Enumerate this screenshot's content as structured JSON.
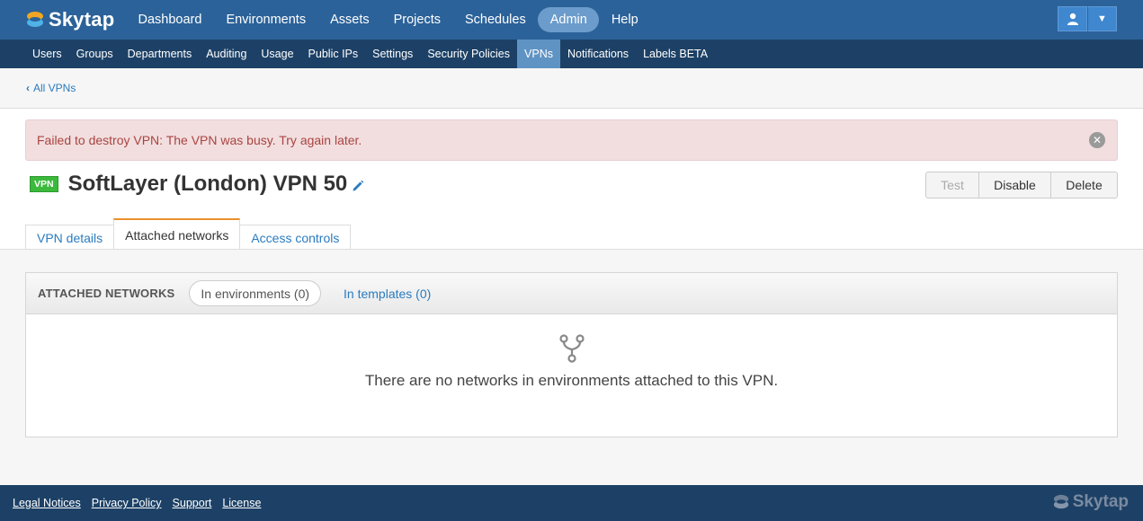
{
  "brand": {
    "name": "Skytap"
  },
  "topnav": {
    "items": [
      {
        "label": "Dashboard"
      },
      {
        "label": "Environments"
      },
      {
        "label": "Assets"
      },
      {
        "label": "Projects"
      },
      {
        "label": "Schedules"
      },
      {
        "label": "Admin",
        "active": true
      },
      {
        "label": "Help"
      }
    ],
    "user_icon": "user-icon",
    "caret_label": "▼"
  },
  "subnav": {
    "items": [
      {
        "label": "Users"
      },
      {
        "label": "Groups"
      },
      {
        "label": "Departments"
      },
      {
        "label": "Auditing"
      },
      {
        "label": "Usage"
      },
      {
        "label": "Public IPs"
      },
      {
        "label": "Settings"
      },
      {
        "label": "Security Policies"
      },
      {
        "label": "VPNs",
        "active": true
      },
      {
        "label": "Notifications"
      },
      {
        "label": "Labels BETA"
      }
    ]
  },
  "breadcrumb": {
    "label": "All VPNs"
  },
  "alert": {
    "message": "Failed to destroy VPN: The VPN was busy. Try again later.",
    "close_label": "✕"
  },
  "vpn": {
    "badge": "VPN",
    "title": "SoftLayer (London) VPN 50"
  },
  "actions": {
    "test": "Test",
    "disable": "Disable",
    "delete": "Delete"
  },
  "tabs": [
    {
      "label": "VPN details"
    },
    {
      "label": "Attached networks",
      "active": true
    },
    {
      "label": "Access controls"
    }
  ],
  "panel": {
    "title": "ATTACHED NETWORKS",
    "filter_active": "In environments (0)",
    "filter_other": "In templates (0)",
    "empty_message": "There are no networks in environments attached to this VPN."
  },
  "footer": {
    "links": [
      "Legal Notices",
      "Privacy Policy",
      "Support",
      "License"
    ],
    "brand": "Skytap"
  },
  "colors": {
    "topbar": "#2b6299",
    "subbar": "#1d4166",
    "accent_tab": "#e8902e",
    "badge": "#3cb93c",
    "link": "#2a7bbf"
  }
}
